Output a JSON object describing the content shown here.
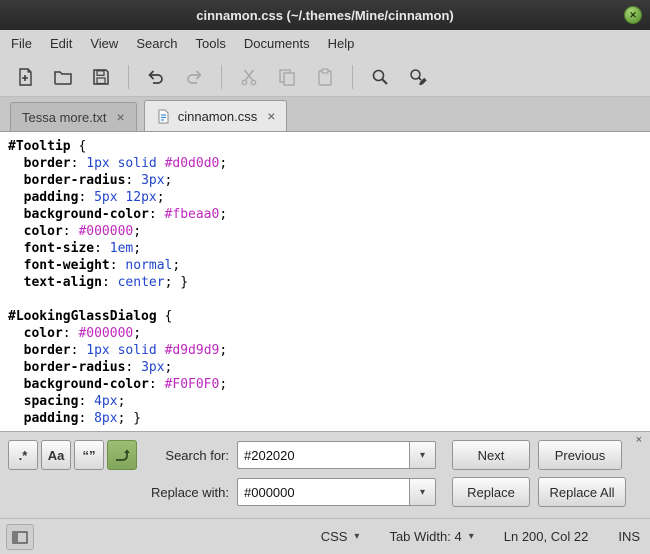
{
  "window": {
    "title": "cinnamon.css (~/.themes/Mine/cinnamon)"
  },
  "icons": {
    "window_close": "✕",
    "tab_close": "×",
    "panel_close": "×",
    "dropdown": "▾"
  },
  "colors": {
    "accent_green": "#8fb56a",
    "syntax_value_blue": "#2145cc",
    "syntax_hex_magenta": "#bf28bf",
    "titlebar": "#2e2e2e"
  },
  "menu": {
    "items": [
      "File",
      "Edit",
      "View",
      "Search",
      "Tools",
      "Documents",
      "Help"
    ]
  },
  "toolbar": {
    "buttons": [
      {
        "name": "new-document",
        "enabled": true
      },
      {
        "name": "open",
        "enabled": true
      },
      {
        "name": "save",
        "enabled": true
      },
      {
        "name": "undo",
        "enabled": true
      },
      {
        "name": "redo",
        "enabled": false
      },
      {
        "name": "cut",
        "enabled": false
      },
      {
        "name": "copy",
        "enabled": false
      },
      {
        "name": "paste",
        "enabled": false
      },
      {
        "name": "search",
        "enabled": true
      },
      {
        "name": "search-and-replace",
        "enabled": true
      }
    ]
  },
  "tabs": [
    {
      "label": "Tessa more.txt",
      "active": false
    },
    {
      "label": "cinnamon.css",
      "active": true
    }
  ],
  "editor": {
    "lines": [
      [
        {
          "t": "#Tooltip",
          "c": "s"
        },
        {
          "t": " {"
        }
      ],
      [
        {
          "t": "  "
        },
        {
          "t": "border",
          "c": "p"
        },
        {
          "t": ": "
        },
        {
          "t": "1px solid",
          "c": "v"
        },
        {
          "t": " "
        },
        {
          "t": "#d0d0d0",
          "c": "h"
        },
        {
          "t": ";"
        }
      ],
      [
        {
          "t": "  "
        },
        {
          "t": "border-radius",
          "c": "p"
        },
        {
          "t": ": "
        },
        {
          "t": "3px",
          "c": "v"
        },
        {
          "t": ";"
        }
      ],
      [
        {
          "t": "  "
        },
        {
          "t": "padding",
          "c": "p"
        },
        {
          "t": ": "
        },
        {
          "t": "5px 12px",
          "c": "v"
        },
        {
          "t": ";"
        }
      ],
      [
        {
          "t": "  "
        },
        {
          "t": "background-color",
          "c": "p"
        },
        {
          "t": ": "
        },
        {
          "t": "#fbeaa0",
          "c": "h"
        },
        {
          "t": ";"
        }
      ],
      [
        {
          "t": "  "
        },
        {
          "t": "color",
          "c": "p"
        },
        {
          "t": ": "
        },
        {
          "t": "#000000",
          "c": "h"
        },
        {
          "t": ";"
        }
      ],
      [
        {
          "t": "  "
        },
        {
          "t": "font-size",
          "c": "p"
        },
        {
          "t": ": "
        },
        {
          "t": "1em",
          "c": "v"
        },
        {
          "t": ";"
        }
      ],
      [
        {
          "t": "  "
        },
        {
          "t": "font-weight",
          "c": "p"
        },
        {
          "t": ": "
        },
        {
          "t": "normal",
          "c": "v"
        },
        {
          "t": ";"
        }
      ],
      [
        {
          "t": "  "
        },
        {
          "t": "text-align",
          "c": "p"
        },
        {
          "t": ": "
        },
        {
          "t": "center",
          "c": "v"
        },
        {
          "t": "; }"
        }
      ],
      [],
      [
        {
          "t": "#LookingGlassDialog",
          "c": "s"
        },
        {
          "t": " {"
        }
      ],
      [
        {
          "t": "  "
        },
        {
          "t": "color",
          "c": "p"
        },
        {
          "t": ": "
        },
        {
          "t": "#000000",
          "c": "h"
        },
        {
          "t": ";"
        }
      ],
      [
        {
          "t": "  "
        },
        {
          "t": "border",
          "c": "p"
        },
        {
          "t": ": "
        },
        {
          "t": "1px solid",
          "c": "v"
        },
        {
          "t": " "
        },
        {
          "t": "#d9d9d9",
          "c": "h"
        },
        {
          "t": ";"
        }
      ],
      [
        {
          "t": "  "
        },
        {
          "t": "border-radius",
          "c": "p"
        },
        {
          "t": ": "
        },
        {
          "t": "3px",
          "c": "v"
        },
        {
          "t": ";"
        }
      ],
      [
        {
          "t": "  "
        },
        {
          "t": "background-color",
          "c": "p"
        },
        {
          "t": ": "
        },
        {
          "t": "#F0F0F0",
          "c": "h"
        },
        {
          "t": ";"
        }
      ],
      [
        {
          "t": "  "
        },
        {
          "t": "spacing",
          "c": "p"
        },
        {
          "t": ": "
        },
        {
          "t": "4px",
          "c": "v"
        },
        {
          "t": ";"
        }
      ],
      [
        {
          "t": "  "
        },
        {
          "t": "padding",
          "c": "p"
        },
        {
          "t": ": "
        },
        {
          "t": "8px",
          "c": "v"
        },
        {
          "t": "; }"
        }
      ]
    ]
  },
  "search_bar": {
    "regex_toggle": ".*",
    "case_toggle": "Aa",
    "word_toggle": "“”",
    "search_label": "Search for:",
    "search_value": "#202020",
    "next_button": "Next",
    "previous_button": "Previous",
    "replace_label": "Replace with:",
    "replace_value": "#000000",
    "replace_button": "Replace",
    "replace_all_button": "Replace All"
  },
  "status_bar": {
    "language": "CSS",
    "tab_width": "Tab Width: 4",
    "cursor_position": "Ln 200, Col 22",
    "input_mode": "INS"
  }
}
